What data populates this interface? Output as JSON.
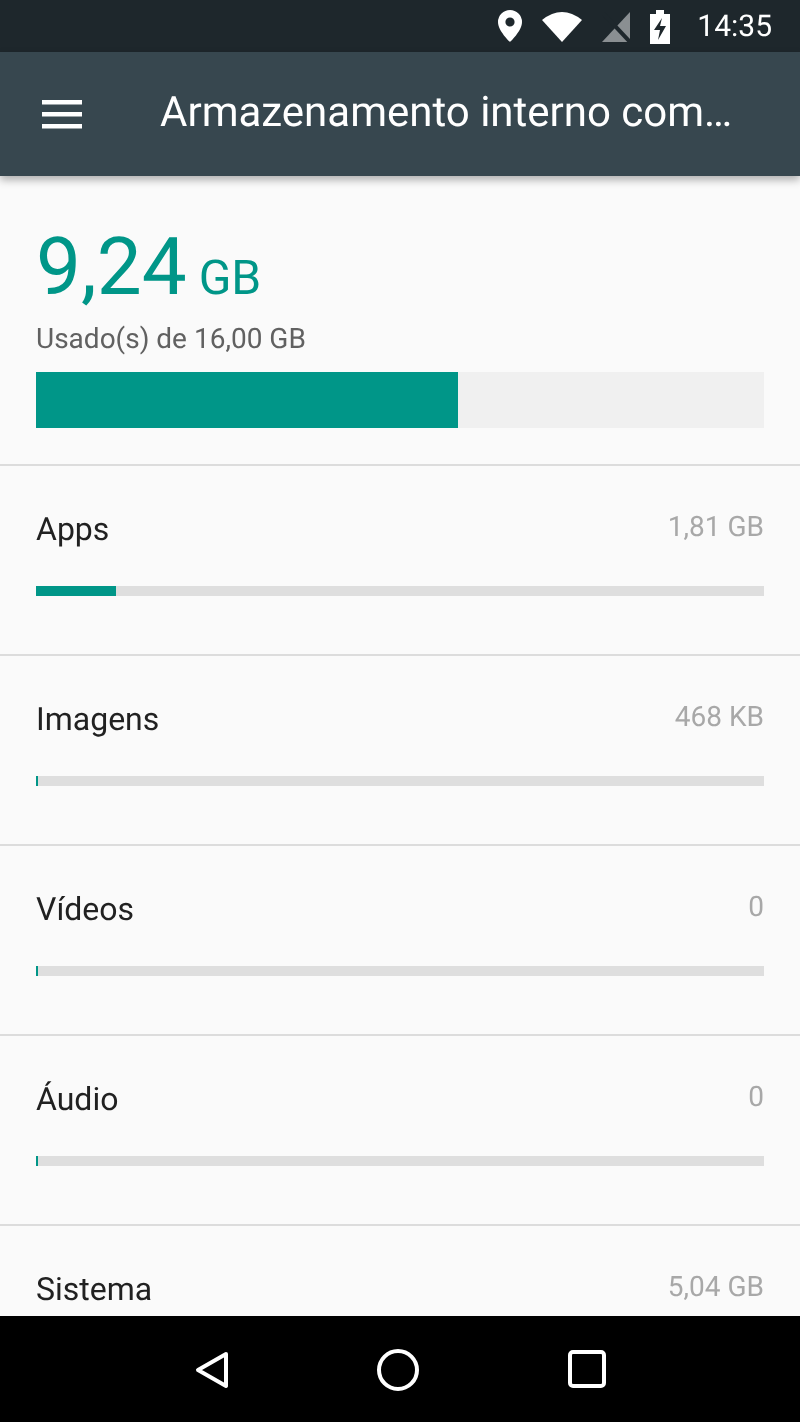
{
  "status_bar": {
    "time": "14:35"
  },
  "app_bar": {
    "title": "Armazenamento interno com…"
  },
  "summary": {
    "used": "9,24",
    "unit": "GB",
    "caption": "Usado(s) de 16,00 GB",
    "level": 0.58
  },
  "categories": [
    {
      "name": "Apps",
      "size": "1,81 GB",
      "level": 0.11
    },
    {
      "name": "Imagens",
      "size": "468 KB",
      "level": 0
    },
    {
      "name": "Vídeos",
      "size": "0",
      "level": 0
    },
    {
      "name": "Áudio",
      "size": "0",
      "level": 0
    },
    {
      "name": "Sistema",
      "size": "5,04 GB"
    }
  ]
}
